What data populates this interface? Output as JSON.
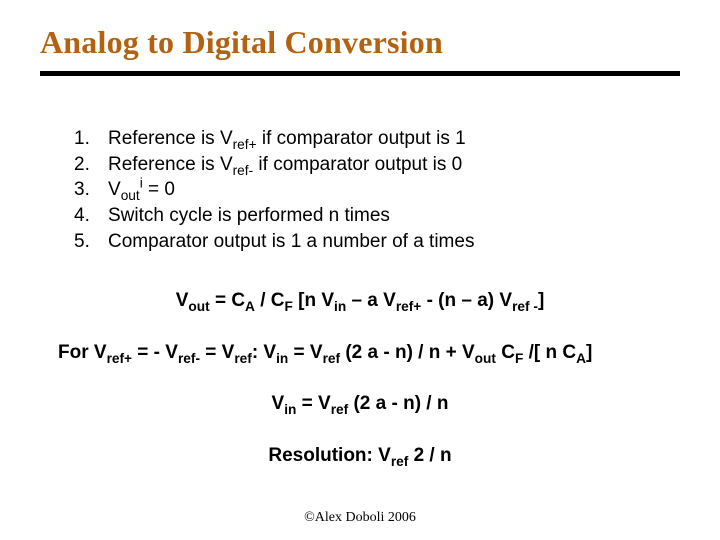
{
  "title": "Analog to Digital Conversion",
  "list": {
    "n1": "1.",
    "n2": "2.",
    "n3": "3.",
    "n4": "4.",
    "n5": "5.",
    "i1_a": "Reference is V",
    "i1_sub": "ref+",
    "i1_b": " if comparator output is 1",
    "i2_a": "Reference is V",
    "i2_sub": "ref-",
    "i2_b": " if comparator output is 0",
    "i3_a": "V",
    "i3_sub": "out",
    "i3_sup": "i",
    "i3_b": " = 0",
    "i4": "Switch cycle is performed n times",
    "i5": "Comparator output is 1 a number of a times"
  },
  "eq1": {
    "p1": "V",
    "s1": "out",
    "p2": " = C",
    "s2": "A",
    "p3": " / C",
    "s3": "F",
    "p4": " [n V",
    "s4": "in",
    "p5": " – a V",
    "s5": "ref+",
    "p6": " - (n – a) V",
    "s6": "ref -",
    "p7": "]"
  },
  "eq2": {
    "p1": "For V",
    "s1": "ref+",
    "p2": " = - V",
    "s2": "ref-",
    "p3": " = V",
    "s3": "ref",
    "p4": ": V",
    "s4": "in",
    "p5": " = V",
    "s5": "ref",
    "p6": " (2 a - n) / n + V",
    "s6": "out",
    "p7": " C",
    "s7": "F",
    "p8": " /[ n C",
    "s8": "A",
    "p9": "]"
  },
  "eq3": {
    "p1": "V",
    "s1": "in",
    "p2": " = V",
    "s2": "ref",
    "p3": " (2 a - n) / n"
  },
  "eq4": {
    "p1": "Resolution: V",
    "s1": "ref",
    "p2": " 2 / n"
  },
  "footer": "©Alex Doboli 2006"
}
